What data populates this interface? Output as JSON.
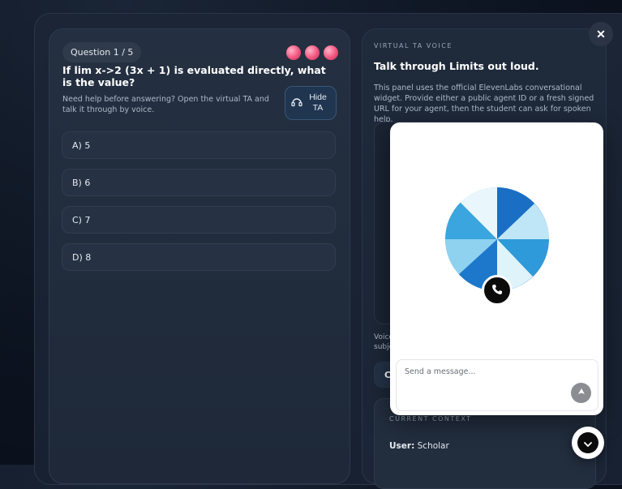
{
  "quiz": {
    "badge": "Question 1 / 5",
    "question": "If lim x->2 (3x + 1) is evaluated directly, what is the value?",
    "help_text": "Need help before answering? Open the virtual TA and talk it through by voice.",
    "hide_ta_label": "Hide TA",
    "options": [
      "A) 5",
      "B) 6",
      "C) 7",
      "D) 8"
    ]
  },
  "ta": {
    "eyebrow": "VIRTUAL TA VOICE",
    "title": "Talk through Limits out loud.",
    "description": "This panel uses the official ElevenLabs conversational widget. Provide either a public agent ID or a fresh signed URL for your agent, then the student can ask for spoken help.",
    "voice_note_line1": "Voice",
    "voice_note_line2": "subje",
    "cta_label": "C",
    "context_eyebrow": "CURRENT CONTEXT",
    "context_user_label": "User:",
    "context_user_value": "Scholar"
  },
  "widget": {
    "message_placeholder": "Send a message..."
  },
  "colors": {
    "accent_pink": "#f1557f",
    "orb_blue": "#2f8fd8",
    "panel_bg": "#1f2a3b"
  }
}
